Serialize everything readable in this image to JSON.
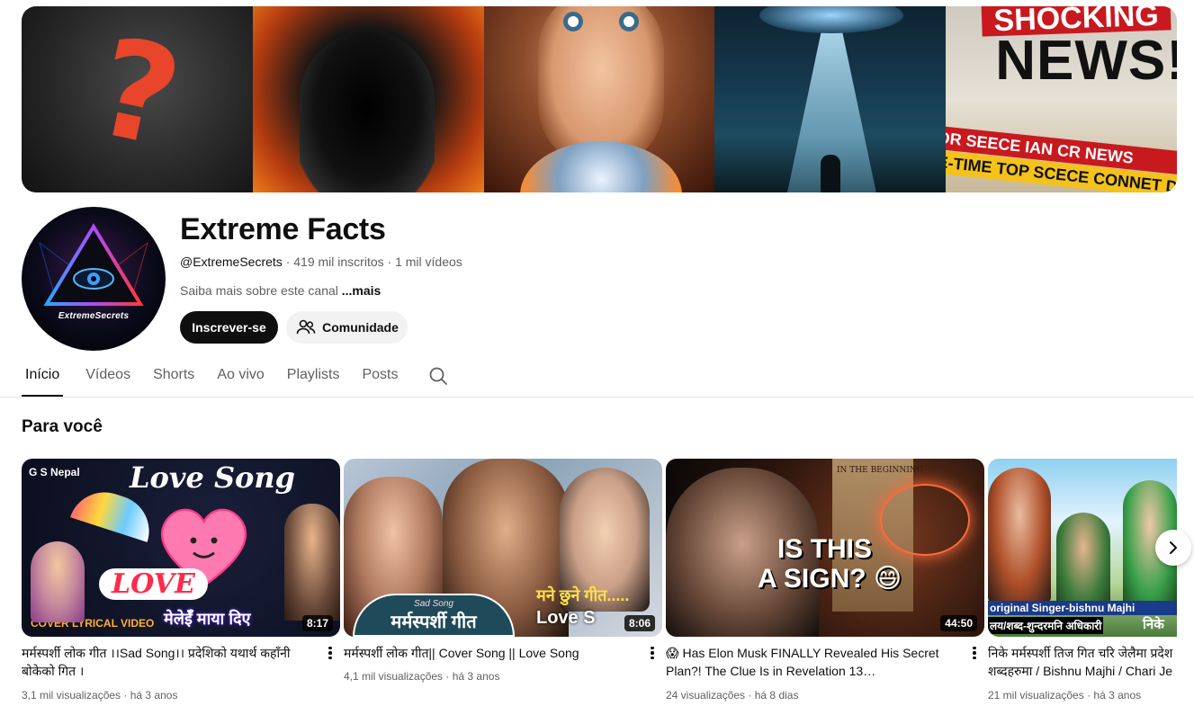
{
  "channel": {
    "name": "Extreme Facts",
    "handle": "@ExtremeSecrets",
    "subscribers": "419 mil inscritos",
    "videos_count": "1 mil vídeos",
    "separator": "·",
    "about": "Saiba mais sobre este canal",
    "about_more": "...mais",
    "avatar_text": "ExtremeSecrets"
  },
  "banner": {
    "qmark": "?",
    "news_top": "SHOCKING",
    "news_main": "NEWS!",
    "tape1": "OR SEECE IAN CR NEWS",
    "tape2": "E-TIME TOP SCECE CONNET DO NOT C"
  },
  "buttons": {
    "subscribe": "Inscrever-se",
    "community": "Comunidade"
  },
  "tabs": [
    "Início",
    "Vídeos",
    "Shorts",
    "Ao vivo",
    "Playlists",
    "Posts"
  ],
  "section": {
    "title": "Para você"
  },
  "videos": [
    {
      "title": "मर्मस्पर्शी लोक गीत ।।Sad Song।। प्रदेशिको यथार्थ कहाँनी बोकेको गित ।",
      "duration": "8:17",
      "views": "3,1 mil visualizações",
      "age": "há 3 anos",
      "thumb_tag": "G S Nepal",
      "thumb_line1": "Love Song",
      "thumb_line2": "LOVE",
      "thumb_line3": "मेलेईँ माया दिए",
      "thumb_line4": "COVER LYRICAL VIDEO"
    },
    {
      "title": "मर्मस्पर्शी लोक गीत|| Cover Song || Love Song",
      "duration": "8:06",
      "views": "4,1 mil visualizações",
      "age": "há 3 anos",
      "thumb_line1": "मर्मस्पर्शी गीत",
      "thumb_line2": "मने छुने गीत.....",
      "thumb_line3": "Love S",
      "thumb_line4": "Sad Song"
    },
    {
      "title": "😱 Has Elon Musk FINALLY Revealed His Secret Plan?! The Clue Is in Revelation 13…",
      "duration": "44:50",
      "views": "24 visualizações",
      "age": "há 8 dias",
      "thumb_line1": "IS THIS",
      "thumb_line2": "A SIGN? 😄",
      "thumb_line3": "IN THE BEGINNING"
    },
    {
      "title": "निके मर्मस्पर्शी तिज गित चरि जेलैमा प्रदेश शब्दहरुमा / Bishnu Majhi / Chari Je",
      "duration": "",
      "views": "21 mil visualizações",
      "age": "há 3 anos",
      "thumb_line1": "original Singer-bishnu Majhi",
      "thumb_line2": "लय/शब्द-शुन्दरमनि अधिकारी",
      "thumb_line3": "निके"
    }
  ]
}
